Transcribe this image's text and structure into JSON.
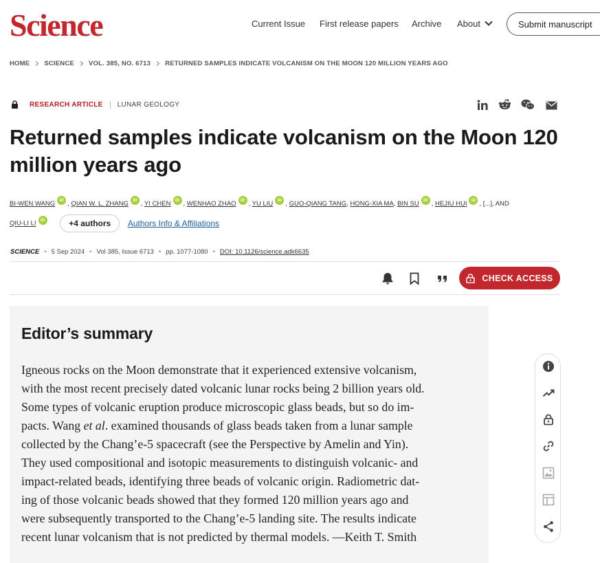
{
  "header": {
    "logo": "Science",
    "nav": [
      "Current Issue",
      "First release papers",
      "Archive",
      "About"
    ],
    "submit_label": "Submit manuscript"
  },
  "breadcrumb": [
    "HOME",
    "SCIENCE",
    "VOL. 385, NO. 6713",
    "RETURNED SAMPLES INDICATE VOLCANISM ON THE MOON 120 MILLION YEARS AGO"
  ],
  "article": {
    "type": "RESEARCH ARTICLE",
    "subject": "LUNAR GEOLOGY",
    "title_lines": [
      "Returned samples indicate volcanism on the Moon 120",
      "million years ago"
    ],
    "authors_line1": [
      "BI-WEN WANG",
      "QIAN W. L. ZHANG",
      "YI CHEN",
      "WENHAO ZHAO",
      "YU LIU",
      "GUO-QIANG TANG",
      "HONG-XIA MA",
      "BIN SU",
      "HEJIU HUI"
    ],
    "authors_ellipsis": "[...], AND",
    "authors_line2": [
      "QIU-LI LI"
    ],
    "more_authors": "+4 authors",
    "affiliations_link": "Authors Info & Affiliations",
    "journal": "SCIENCE",
    "date": "5 Sep 2024",
    "volume_issue": "Vol 385, Issue 6713",
    "pages": "pp. 1077-1080",
    "doi": "DOI: 10.1126/science.adk6635",
    "access_label": "CHECK ACCESS",
    "orcid_label": "iD"
  },
  "summary": {
    "heading": "Editor’s summary",
    "lines": [
      "Igneous rocks on the Moon demonstrate that it experienced extensive volcanism,",
      "with the most recent precisely dated volcanic lunar rocks being 2 billion years old.",
      "Some types of volcanic eruption produce microscopic glass beads, but so do im-",
      "pacts. Wang ||et al||. examined thousands of glass beads taken from a lunar sample",
      "collected by the Chang’e-5 spacecraft (see the Perspective by Amelin and Yin).",
      "They used compositional and isotopic measurements to distinguish volcanic- and",
      "impact-related beads, identifying three beads of volcanic origin. Radiometric dat-",
      "ing of those volcanic beads showed that they formed 120 million years ago and",
      "were subsequently transported to the Chang’e-5 landing site. The results indicate",
      "recent lunar volcanism that is not predicted by thermal models. —Keith T. Smith"
    ]
  },
  "colors": {
    "brand_red": "#c1272d",
    "orcid_green": "#a6ce39",
    "link_blue": "#1f5f9e"
  },
  "icons": {
    "share": [
      "linkedin-icon",
      "reddit-icon",
      "wechat-icon",
      "email-icon"
    ],
    "actions": [
      "bell-icon",
      "bookmark-icon",
      "cite-quote-icon"
    ],
    "tools": [
      "info-icon",
      "metrics-icon",
      "access-lock-icon",
      "link-icon",
      "figures-icon",
      "tables-icon",
      "share-icon"
    ]
  }
}
